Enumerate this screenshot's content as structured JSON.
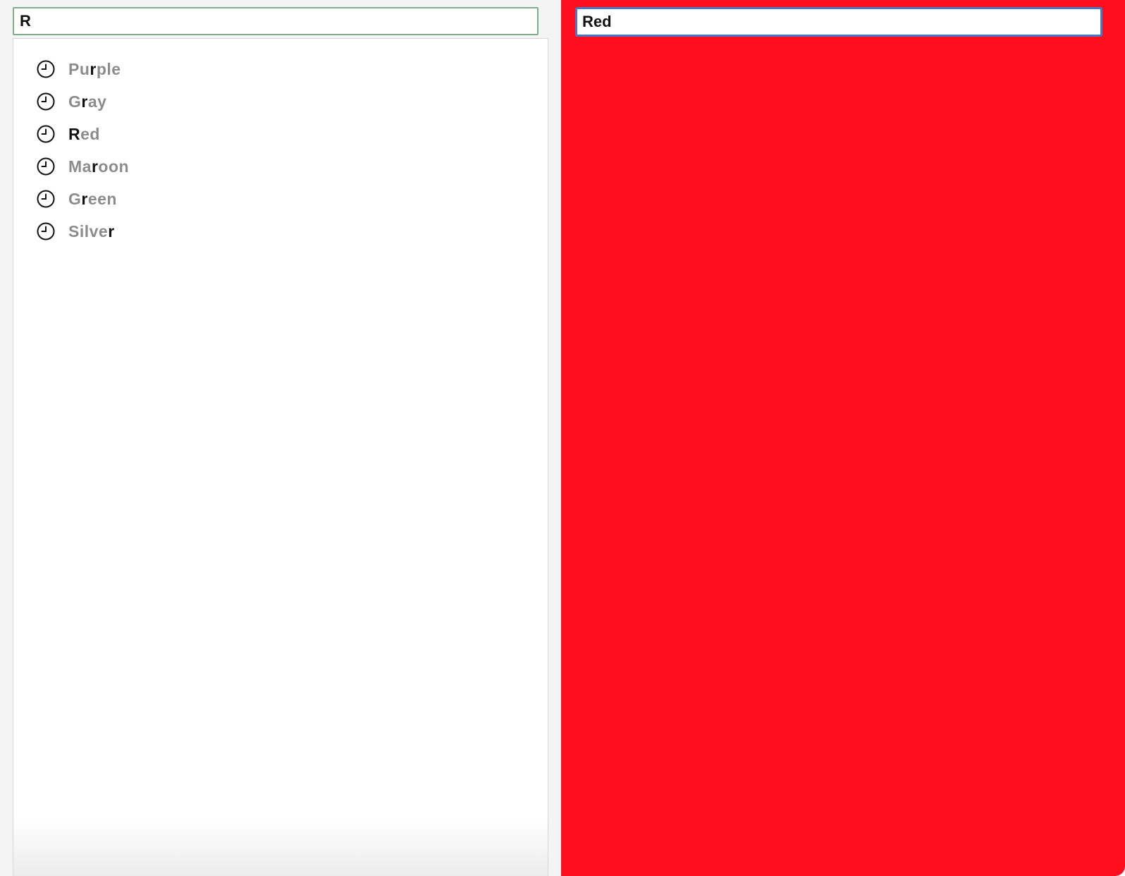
{
  "left": {
    "search": {
      "value": "R"
    },
    "suggestions": [
      {
        "label": "Purple",
        "parts": [
          {
            "t": "Pu",
            "hl": false
          },
          {
            "t": "r",
            "hl": true
          },
          {
            "t": "ple",
            "hl": false
          }
        ],
        "icon": "clock-icon"
      },
      {
        "label": "Gray",
        "parts": [
          {
            "t": "G",
            "hl": false
          },
          {
            "t": "r",
            "hl": true
          },
          {
            "t": "ay",
            "hl": false
          }
        ],
        "icon": "clock-icon"
      },
      {
        "label": "Red",
        "parts": [
          {
            "t": "R",
            "hl": true
          },
          {
            "t": "ed",
            "hl": false
          }
        ],
        "icon": "clock-icon"
      },
      {
        "label": "Maroon",
        "parts": [
          {
            "t": "Ma",
            "hl": false
          },
          {
            "t": "r",
            "hl": true
          },
          {
            "t": "oon",
            "hl": false
          }
        ],
        "icon": "clock-icon"
      },
      {
        "label": "Green",
        "parts": [
          {
            "t": "G",
            "hl": false
          },
          {
            "t": "r",
            "hl": true
          },
          {
            "t": "een",
            "hl": false
          }
        ],
        "icon": "clock-icon"
      },
      {
        "label": "Silver",
        "parts": [
          {
            "t": "Silve",
            "hl": false
          },
          {
            "t": "r",
            "hl": true
          }
        ],
        "icon": "clock-icon"
      }
    ]
  },
  "right": {
    "color_input": {
      "value": "Red"
    },
    "background_color": "#ff0f1e"
  },
  "colors": {
    "highlight_text": "#111111",
    "muted_text": "#8c8c8c",
    "left_focus_border": "#7fae8e",
    "right_focus_border": "#4a77c9"
  }
}
